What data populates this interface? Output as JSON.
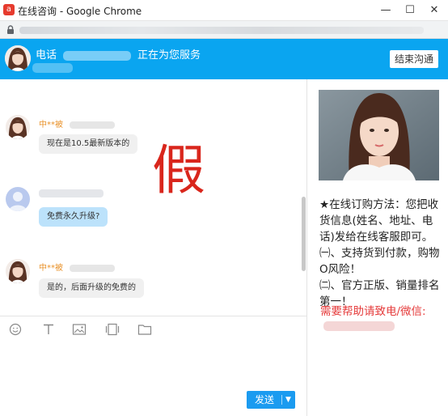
{
  "window": {
    "title": "在线咨询 - Google Chrome",
    "app_icon_glyph": "a"
  },
  "controls": {
    "minimize": "—",
    "maximize": "☐",
    "close": "✕"
  },
  "header": {
    "prefix": "电话",
    "status": "正在为您服务",
    "end_button": "结束沟通"
  },
  "messages": [
    {
      "from": "agent",
      "name": "中**被",
      "text": "现在是10.5最新版本的"
    },
    {
      "from": "user",
      "text": "免费永久升级?"
    },
    {
      "from": "agent",
      "name": "中**被",
      "text": "是的，后面升级的免费的"
    }
  ],
  "watermark": "假",
  "toolbar": {
    "icons": [
      "emoji-icon",
      "text-format-icon",
      "image-icon",
      "screenshot-icon",
      "folder-icon"
    ]
  },
  "send": {
    "label": "发送",
    "caret": "▼"
  },
  "side": {
    "promo": [
      "★在线订购方法：您把收货信息(姓名、地址、电话)发给在线客服即可。",
      "㈠、支持货到付款，购物O风险！",
      "㈡、官方正版、销量排名第一！"
    ],
    "help": "需要帮助请致电/微信:"
  },
  "colors": {
    "header_bg": "#0aa5f0",
    "send_bg": "#1b9bf0",
    "agent_name": "#e9932c",
    "help_text": "#e53a3a",
    "watermark": "#d9261c",
    "user_bubble": "#bce2fb"
  }
}
